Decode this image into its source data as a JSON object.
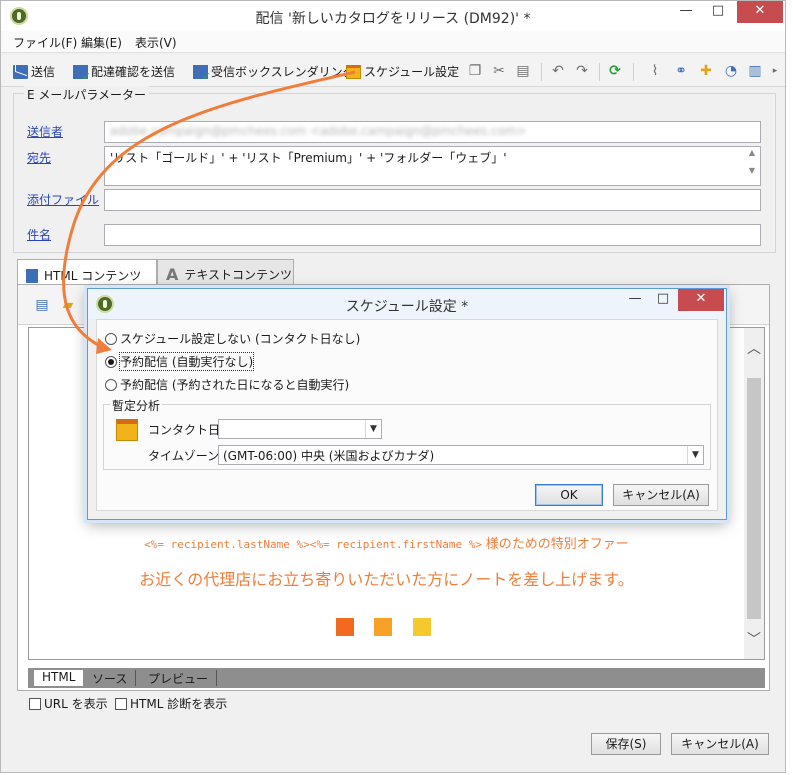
{
  "window": {
    "title": "配信 '新しいカタログをリリース (DM92)' *",
    "minimize": "—",
    "maximize": "□",
    "close": "✕"
  },
  "menu": [
    "ファイル(F)",
    "編集(E)",
    "表示(V)"
  ],
  "toolbar": {
    "send": "送信",
    "send_proof": "配達確認を送信",
    "inbox_rendering": "受信ボックスレンダリング",
    "schedule": "スケジュール設定"
  },
  "email_params": {
    "group_title": "E メールパラメーター",
    "sender_label": "送信者",
    "sender_value": "adobe.campaign@pmchees.com <adobe.campaign@pmchees.com>",
    "to_label": "宛先",
    "to_value": "'リスト「ゴールド」' + 'リスト「Premium」' + 'フォルダー「ウェブ」'",
    "attach_label": "添付ファイル",
    "attach_value": "",
    "subject_label": "件名",
    "subject_value": ""
  },
  "content_tabs": {
    "html": "HTML コンテンツ",
    "text": "テキストコンテンツ"
  },
  "editor": {
    "template_code": "<%= recipient.lastName %><%= recipient.firstName %>",
    "template_suffix": "様のための特別オファー",
    "headline": "お近くの代理店にお立ち寄りいただいた方にノートを差し上げます。",
    "squares": [
      "#f26a1f",
      "#f7a227",
      "#f7c82d"
    ],
    "bottom_tabs": [
      "HTML",
      "ソース",
      "プレビュー"
    ],
    "show_url": "URL を表示",
    "show_diag": "HTML 診断を表示"
  },
  "buttons": {
    "save": "保存(S)",
    "cancel": "キャンセル(A)"
  },
  "dialog": {
    "title": "スケジュール設定 *",
    "option1": "スケジュール設定しない (コンタクト日なし)",
    "option2": "予約配信 (自動実行なし)",
    "option3": "予約配信 (予約された日になると自動実行)",
    "selected_option": 2,
    "fieldset_title": "暫定分析",
    "contact_date_label": "コンタクト日:",
    "contact_date_value": "",
    "timezone_label": "タイムゾーン:",
    "timezone_value": "(GMT-06:00) 中央 (米国およびカナダ)",
    "ok": "OK",
    "cancel": "キャンセル(A)"
  },
  "colors": {
    "accent_orange": "#f07d3b",
    "link_blue": "#2946b3",
    "close_red": "#c74c50",
    "dialog_border": "#5f9ad8"
  }
}
